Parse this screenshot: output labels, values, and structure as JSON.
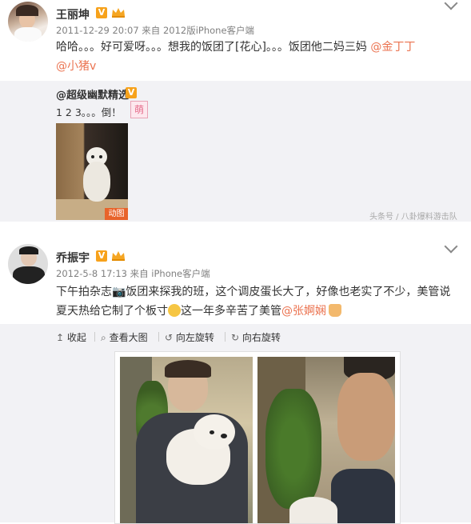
{
  "post1": {
    "author": "王丽坤",
    "v_badge": "V",
    "meta": "2011-12-29 20:07 来自 2012版iPhone客户端",
    "text_plain": "哈哈。。。好可爱呀。。。想我的饭团了[花心]。。。饭团他二妈三妈",
    "mention1": "@金丁丁",
    "mention2": "@小猪v",
    "repost": {
      "author": "@超级幽默精选",
      "v_badge": "V",
      "text": "1 2 3。。。倒！",
      "sticker": "萌",
      "image_label": "动图"
    }
  },
  "watermark": "头条号 / 八卦爆料游击队",
  "post2": {
    "author": "乔振宇",
    "v_badge": "V",
    "meta": "2012-5-8 17:13 来自 iPhone客户端",
    "text_line1": "下午拍杂志📷饭团来探我的班，这个调皮蛋长大了，好像也老实了不少，美管说",
    "text_line2_a": "夏天热给它制了个板寸",
    "text_line2_b": "这一年多辛苦了美管",
    "mention": "@张婀娴",
    "toolbar": {
      "collapse": "收起",
      "view_large": "查看大图",
      "rotate_left": "向左旋转",
      "rotate_right": "向右旋转"
    }
  }
}
